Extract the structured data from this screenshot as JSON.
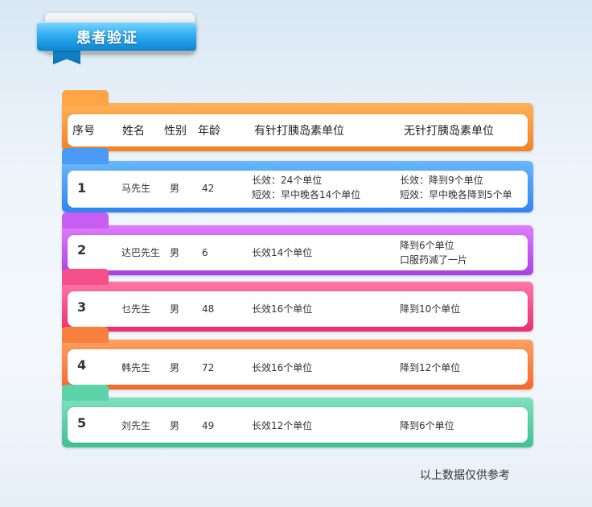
{
  "title": "患者验证",
  "headers": {
    "index": "序号",
    "name": "姓名",
    "gender": "性别",
    "age": "年龄",
    "with_needle": "有针打胰岛素单位",
    "without_needle": "无针打胰岛素单位"
  },
  "rows": [
    {
      "index": "1",
      "name": "马先生",
      "gender": "男",
      "age": "42",
      "with_needle_1": "长效：24个单位",
      "with_needle_2": "短效：早中晚各14个单位",
      "without_needle_1": "长效：降到9个单位",
      "without_needle_2": "短效：早中晚各降到5个单"
    },
    {
      "index": "2",
      "name": "达巴先生",
      "gender": "男",
      "age": "6",
      "with_needle_1": "长效14个单位",
      "without_needle_1": "降到6个单位",
      "without_needle_2": "口服药减了一片"
    },
    {
      "index": "3",
      "name": "乜先生",
      "gender": "男",
      "age": "48",
      "with_needle_1": "长效16个单位",
      "without_needle_1": "降到10个单位"
    },
    {
      "index": "4",
      "name": "韩先生",
      "gender": "男",
      "age": "72",
      "with_needle_1": "长效16个单位",
      "without_needle_1": "降到12个单位"
    },
    {
      "index": "5",
      "name": "刘先生",
      "gender": "男",
      "age": "49",
      "with_needle_1": "长效12个单位",
      "without_needle_1": "降到6个单位"
    }
  ],
  "footer_note": "以上数据仅供参考",
  "colors": {
    "header": "#f58222",
    "row1": "#2f86f0",
    "row2": "#a742e8",
    "row3": "#ea2f6e",
    "row4": "#f4692c",
    "row5": "#3ec192",
    "ribbon": "#31aef0"
  }
}
